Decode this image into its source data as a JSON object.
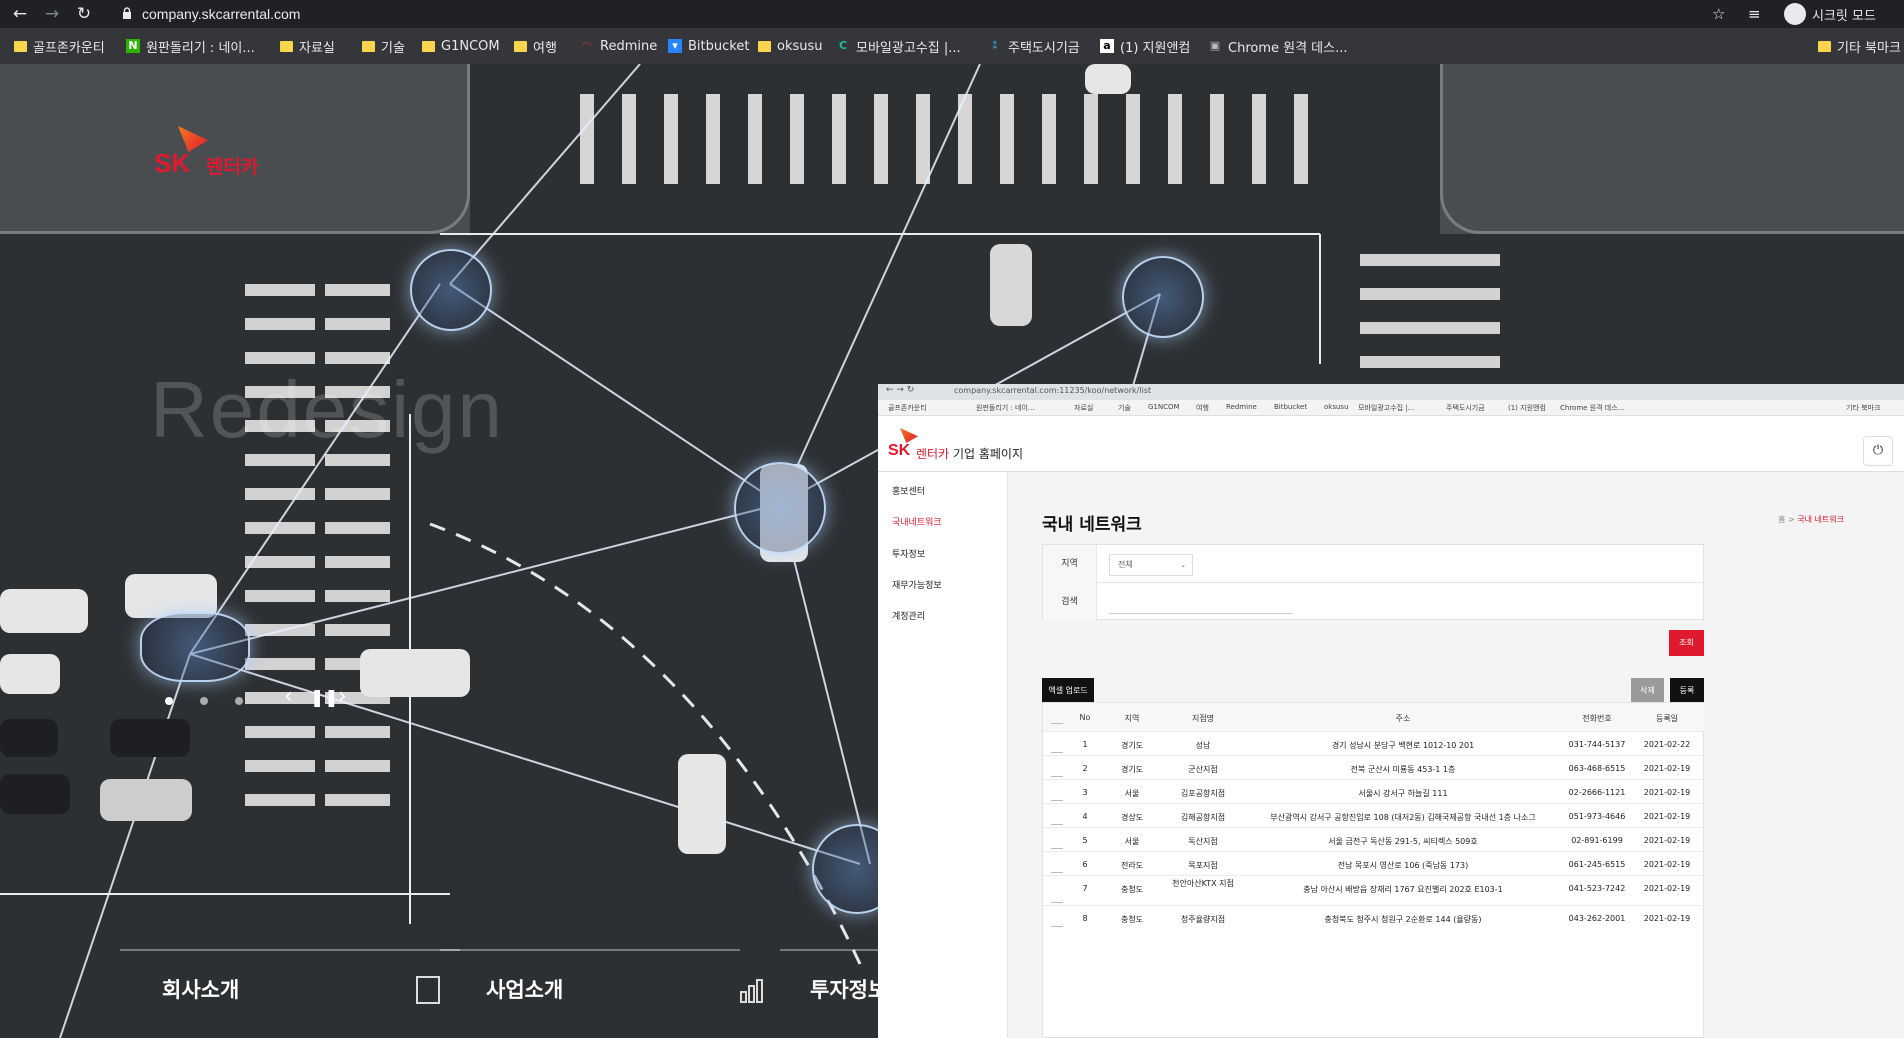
{
  "browser": {
    "url": "company.skcarrental.com",
    "incognito_label": "시크릿 모드",
    "bookmarks": [
      {
        "label": "골프존카운티",
        "icon": "folder"
      },
      {
        "label": "원판돌리기 : 네이...",
        "icon": "naver"
      },
      {
        "label": "자료실",
        "icon": "folder"
      },
      {
        "label": "기술",
        "icon": "folder"
      },
      {
        "label": "G1NCOM",
        "icon": "folder"
      },
      {
        "label": "여행",
        "icon": "folder"
      },
      {
        "label": "Redmine",
        "icon": "redmine"
      },
      {
        "label": "Bitbucket",
        "icon": "bitbucket"
      },
      {
        "label": "oksusu",
        "icon": "folder"
      },
      {
        "label": "모바일광고수집 |...",
        "icon": "c"
      },
      {
        "label": "주택도시기금",
        "icon": "hug"
      },
      {
        "label": "(1) 지원앤컴",
        "icon": "a"
      },
      {
        "label": "Chrome 원격 데스...",
        "icon": "remote"
      },
      {
        "label": "기타 북마크",
        "icon": "folder"
      }
    ]
  },
  "hero": {
    "brand_sk": "SK",
    "brand_rent": "렌터카",
    "watermark": "Redesign",
    "menu": [
      "회사소개",
      "사업소개",
      "투자정보"
    ]
  },
  "inner": {
    "url": "company.skcarrental.com:11235/koo/network/list",
    "logo_sk": "SK",
    "logo_rent": "렌터카",
    "logo_rest": " 기업 홈페이지",
    "power_icon": "⏻",
    "sidebar": [
      "홍보센터",
      "국내네트워크",
      "투자정보",
      "재무가능정보",
      "계정관리"
    ],
    "page_title": "국내 네트워크",
    "breadcrumb_home": "홈 >",
    "breadcrumb_current": "국내 네트워크",
    "filter": {
      "region_label": "지역",
      "region_value": "전체",
      "search_label": "검색",
      "search_placeholder": ""
    },
    "buttons": {
      "search": "조회",
      "excel": "엑셀 업로드",
      "delete": "삭제",
      "register": "등록"
    },
    "table": {
      "headers": [
        "No",
        "지역",
        "지점명",
        "주소",
        "전화번호",
        "등록일"
      ],
      "rows": [
        [
          "1",
          "경기도",
          "성남",
          "경기 성남시 분당구 백현로 1012-10 201",
          "031-744-5137",
          "2021-02-22"
        ],
        [
          "2",
          "경기도",
          "군산지점",
          "전북 군산시 미룡동 453-1 1층",
          "063-468-6515",
          "2021-02-19"
        ],
        [
          "3",
          "서울",
          "김포공항지점",
          "서울시 강서구 하늘길 111",
          "02-2666-1121",
          "2021-02-19"
        ],
        [
          "4",
          "경상도",
          "김해공항지점",
          "부산광역시 강서구 공항진입로 108 (대저2동) 김해국제공항 국내선 1층 나소그",
          "051-973-4646",
          "2021-02-19"
        ],
        [
          "5",
          "서울",
          "독산지점",
          "서울 금천구 독산동 291-5, 씨티렉스 509호",
          "02-891-6199",
          "2021-02-19"
        ],
        [
          "6",
          "전라도",
          "목포지점",
          "전남 목포시 영산로 106 (죽남동 173)",
          "061-245-6515",
          "2021-02-19"
        ],
        [
          "7",
          "충청도",
          "천안아산KTX 지점",
          "충남 아산시 배방읍 장재리 1767 요진밸리 202호 E103-1",
          "041-523-7242",
          "2021-02-19"
        ],
        [
          "8",
          "충청도",
          "청주율량지점",
          "충청북도 청주시 청원구 2순환로 144 (율량동)",
          "043-262-2001",
          "2021-02-19"
        ]
      ]
    }
  }
}
